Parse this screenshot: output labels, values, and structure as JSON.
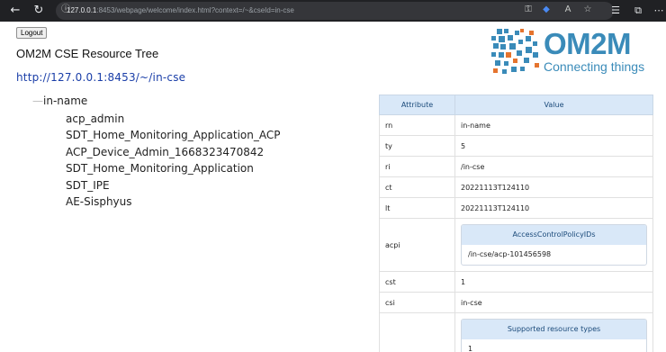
{
  "browser": {
    "address_host": "127.0.0.1",
    "address_rest": ":8453/webpage/welcome/index.html?context=/~&cseId=in-cse",
    "icons": [
      "back-icon",
      "reload-icon",
      "info-icon",
      "key-icon",
      "tag-icon",
      "read-aloud-icon",
      "favorite-icon",
      "favorites-bar-icon",
      "collections-icon",
      "more-icon"
    ]
  },
  "page": {
    "logout_label": "Logout",
    "title": "OM2M CSE Resource Tree",
    "cse_url": "http://127.0.0.1:8453/~/in-cse"
  },
  "logo": {
    "wordmark": "OM2M",
    "tagline": "Connecting things",
    "color": "#3a8bb9"
  },
  "tree": {
    "root": "in-name",
    "children": [
      "acp_admin",
      "SDT_Home_Monitoring_Application_ACP",
      "ACP_Device_Admin_1668323470842",
      "SDT_Home_Monitoring_Application",
      "SDT_IPE",
      "AE-Sisphyus"
    ]
  },
  "attributes": {
    "header": {
      "attribute": "Attribute",
      "value": "Value"
    },
    "rows": [
      {
        "key": "rn",
        "value": "in-name"
      },
      {
        "key": "ty",
        "value": "5"
      },
      {
        "key": "ri",
        "value": "/in-cse"
      },
      {
        "key": "ct",
        "value": "20221113T124110"
      },
      {
        "key": "lt",
        "value": "20221113T124110"
      }
    ],
    "acpi": {
      "key": "acpi",
      "title": "AccessControlPolicyIDs",
      "value": "/in-cse/acp-101456598"
    },
    "rows2": [
      {
        "key": "cst",
        "value": "1"
      },
      {
        "key": "csi",
        "value": "in-cse"
      }
    ],
    "srt": {
      "key": "",
      "title": "Supported resource types",
      "first_value": "1"
    }
  }
}
